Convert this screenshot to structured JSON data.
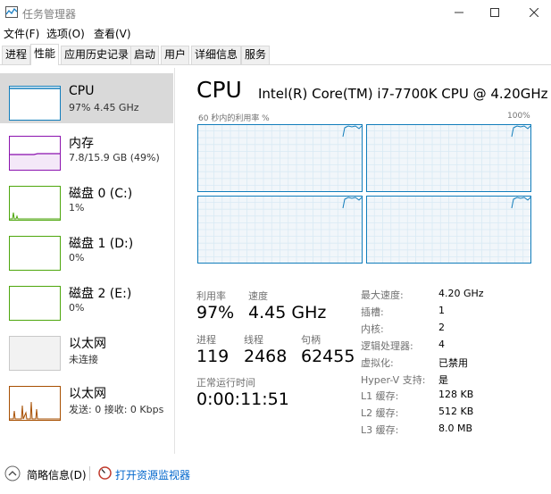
{
  "window": {
    "title": "任务管理器"
  },
  "menu": [
    "文件(F)",
    "选项(O)",
    "查看(V)"
  ],
  "tabs": [
    "进程",
    "性能",
    "应用历史记录",
    "启动",
    "用户",
    "详细信息",
    "服务"
  ],
  "sidebar": [
    {
      "name": "CPU",
      "sub": "97% 4.45 GHz",
      "color": "#117dbb"
    },
    {
      "name": "内存",
      "sub": "7.8/15.9 GB (49%)",
      "color": "#8b12ae"
    },
    {
      "name": "磁盘 0 (C:)",
      "sub": "1%",
      "color": "#4da60c"
    },
    {
      "name": "磁盘 1 (D:)",
      "sub": "0%",
      "color": "#4da60c"
    },
    {
      "name": "磁盘 2 (E:)",
      "sub": "0%",
      "color": "#4da60c"
    },
    {
      "name": "以太网",
      "sub": "未连接",
      "color": "#a0a0a0"
    },
    {
      "name": "以太网",
      "sub": "发送: 0 接收: 0 Kbps",
      "color": "#a74f01"
    }
  ],
  "main": {
    "title": "CPU",
    "model": "Intel(R) Core(TM) i7-7700K CPU @ 4.20GHz",
    "graph_label": "60 秒内的利用率 %",
    "graph_max": "100%",
    "stats": {
      "util_label": "利用率",
      "util_value": "97%",
      "speed_label": "速度",
      "speed_value": "4.45 GHz",
      "proc_label": "进程",
      "proc_value": "119",
      "thread_label": "线程",
      "thread_value": "2468",
      "handle_label": "句柄",
      "handle_value": "62455",
      "uptime_label": "正常运行时间",
      "uptime_value": "0:00:11:51"
    },
    "specs": [
      {
        "key": "最大速度:",
        "value": "4.20 GHz"
      },
      {
        "key": "插槽:",
        "value": "1"
      },
      {
        "key": "内核:",
        "value": "2"
      },
      {
        "key": "逻辑处理器:",
        "value": "4"
      },
      {
        "key": "虚拟化:",
        "value": "已禁用"
      },
      {
        "key": "Hyper-V 支持:",
        "value": "是"
      },
      {
        "key": "L1 缓存:",
        "value": "128 KB"
      },
      {
        "key": "L2 缓存:",
        "value": "512 KB"
      },
      {
        "key": "L3 缓存:",
        "value": "8.0 MB"
      }
    ]
  },
  "footer": {
    "summary": "简略信息(D)",
    "resmon": "打开资源监视器"
  },
  "colors": {
    "cpu_line": "#117dbb",
    "cpu_fill": "#f1f6fa",
    "grid": "#d9eaf4",
    "link": "#0066cc"
  }
}
